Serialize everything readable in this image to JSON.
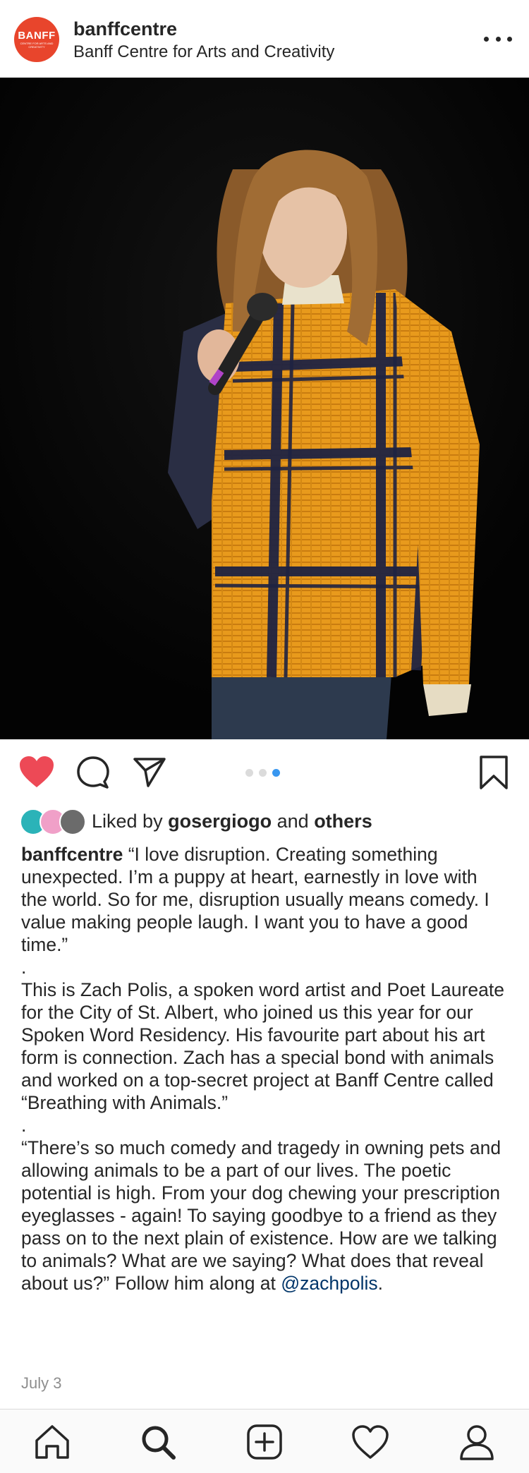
{
  "post": {
    "username": "banffcentre",
    "location": "Banff Centre for Arts and Creativity",
    "avatar_text": "BANFF",
    "avatar_subtext": "CENTRE FOR ARTS AND CREATIVITY"
  },
  "icons": {
    "like": "heart-filled-icon",
    "comment": "comment-icon",
    "share": "send-icon",
    "save": "bookmark-icon",
    "more": "more-options-icon"
  },
  "carousel": {
    "count": 3,
    "active_index": 2
  },
  "likes": {
    "prefix": "Liked by",
    "user": "gosergiogo",
    "conjunction": "and",
    "others": "others"
  },
  "caption": {
    "username": "banffcentre",
    "p1": "“I love disruption. Creating something unexpected. I’m a puppy at heart, earnestly in love with the world. So for me, disruption usually means comedy. I value making people laugh. I want you to have a good time.”",
    "sep1": ".",
    "p2": "This is Zach Polis, a spoken word artist and Poet Laureate for the City of St. Albert, who joined us this year for our Spoken Word Residency. His favourite part about his art form is connection. Zach has a special bond with animals and worked on a top-secret project at Banff Centre called “Breathing with Animals.”",
    "sep2": ".",
    "p3": "“There’s so much comedy and tragedy in owning pets and allowing animals to be a part of our lives. The poetic potential is high. From your dog chewing your prescription eyeglasses - again! To saying goodbye to a friend as they pass on to the next plain of existence. How are we talking to animals? What are we saying? What does that reveal about us?” Follow him along at",
    "mention": "@zachpolis",
    "end": "."
  },
  "date": "July 3",
  "colors": {
    "like_red": "#ed4956",
    "link_blue": "#003569",
    "dot_active": "#3897f0",
    "sweater_orange": "#e89a1c",
    "sweater_navy": "#1f2342"
  }
}
